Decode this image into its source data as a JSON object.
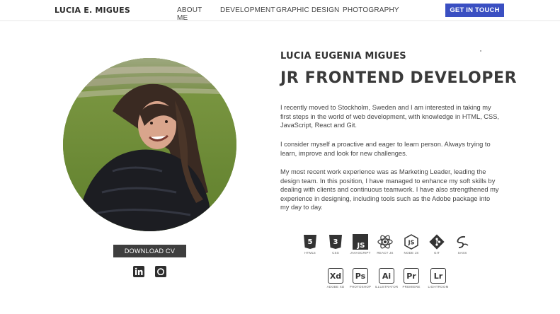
{
  "nav": {
    "brand": "LUCIA E. MIGUES",
    "links": [
      "ABOUT ME",
      "DEVELOPMENT",
      "GRAPHIC DESIGN",
      "PHOTOGRAPHY"
    ],
    "cta": "GET IN TOUCH"
  },
  "profile": {
    "download_cv": "DOWNLOAD CV",
    "social": [
      "linkedin-icon",
      "github-icon"
    ]
  },
  "intro": {
    "name": "LUCIA EUGENIA MIGUES",
    "role": "JR FRONTEND DEVELOPER",
    "paragraphs": [
      "I recently moved to Stockholm, Sweden and I am interested in taking my first steps in the world of web development, with knowledge in HTML, CSS, JavaScript, React and Git.",
      "I consider myself a proactive and eager to learn person. Always trying to learn, improve and look for new challenges.",
      "My most recent work experience was as Marketing Leader, leading the design team. In this position, I have managed to enhance my soft skills by dealing with clients and continuous teamwork. I have also strengthened my experience in designing, including tools such as the Adobe package into my day to day."
    ]
  },
  "skills": {
    "dev": [
      {
        "label": "HTML5",
        "icon": "html5-icon"
      },
      {
        "label": "CSS",
        "icon": "css3-icon"
      },
      {
        "label": "JAVASCRIPT",
        "icon": "js-icon",
        "glyph": "JS"
      },
      {
        "label": "REACT JS",
        "icon": "react-icon"
      },
      {
        "label": "NODE JS",
        "icon": "nodejs-icon"
      },
      {
        "label": "GIT",
        "icon": "git-icon"
      },
      {
        "label": "SASS",
        "icon": "sass-icon"
      }
    ],
    "design": [
      {
        "label": "ADOBE XD",
        "glyph": "Xd"
      },
      {
        "label": "PHOTOSHOP",
        "glyph": "Ps"
      },
      {
        "label": "ILLUSTRATOR",
        "glyph": "Ai"
      },
      {
        "label": "PREMIERE",
        "glyph": "Pr"
      },
      {
        "label": "LIGHTROOM",
        "glyph": "Lr"
      }
    ]
  }
}
